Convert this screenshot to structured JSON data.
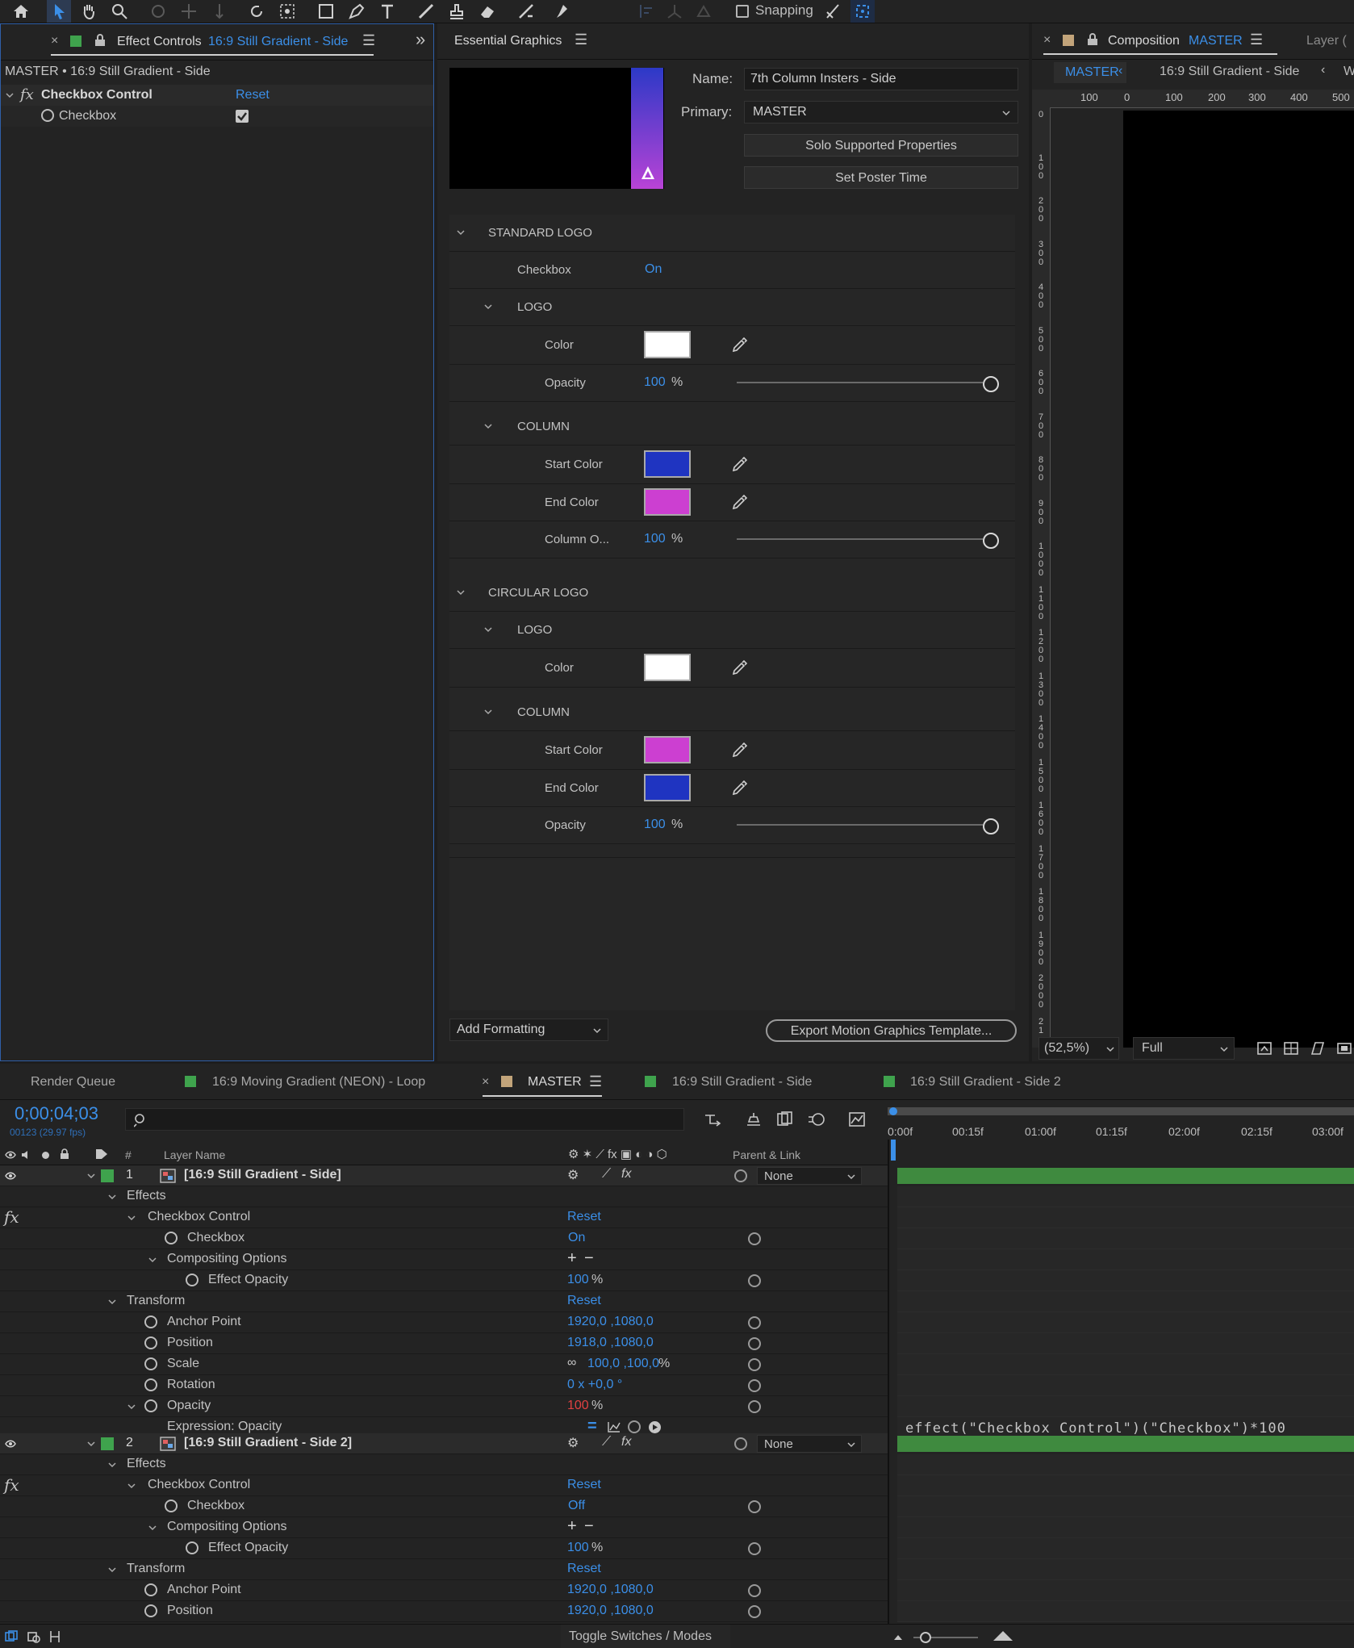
{
  "toolbar": {
    "snapping_label": "Snapping"
  },
  "effect_controls": {
    "tab_title": "Effect Controls",
    "tab_layer": "16:9 Still Gradient - Side",
    "breadcrumb": "MASTER • 16:9 Still Gradient - Side",
    "effect_name": "Checkbox Control",
    "reset_label": "Reset",
    "checkbox_label": "Checkbox",
    "fx_glyph": "fx"
  },
  "essential_graphics": {
    "tab_title": "Essential Graphics",
    "name_label": "Name:",
    "name_value": "7th Column Insters - Side",
    "primary_label": "Primary:",
    "primary_value": "MASTER",
    "solo_button": "Solo Supported Properties",
    "poster_button": "Set Poster Time",
    "add_formatting": "Add Formatting",
    "export_button": "Export Motion Graphics Template...",
    "rows": {
      "standard_logo": "STANDARD LOGO",
      "checkbox_label": "Checkbox",
      "checkbox_value": "On",
      "logo1": "LOGO",
      "color1_label": "Color",
      "opacity1_label": "Opacity",
      "opacity1_value": "100",
      "opacity1_unit": "%",
      "column1": "COLUMN",
      "start1_label": "Start Color",
      "end1_label": "End Color",
      "colop_label": "Column O...",
      "colop_value": "100",
      "colop_unit": "%",
      "circular_logo": "CIRCULAR LOGO",
      "logo2": "LOGO",
      "color2_label": "Color",
      "column2": "COLUMN",
      "start2_label": "Start Color",
      "end2_label": "End Color",
      "opacity2_label": "Opacity",
      "opacity2_value": "100",
      "opacity2_unit": "%"
    },
    "colors": {
      "white": "#ffffff",
      "blue": "#1f34c1",
      "magenta": "#cc3fd1"
    }
  },
  "composition": {
    "tab_label": "Composition",
    "tab_comp": "MASTER",
    "layer_tab": "Layer (",
    "crumb_master": "MASTER",
    "crumb_comp": "16:9 Still Gradient - Side",
    "crumb_w": "W",
    "ruler_ticks": [
      "100",
      "0",
      "100",
      "200",
      "300",
      "400",
      "500"
    ],
    "vruler_ticks": [
      "0",
      "1 0 0",
      "2 0 0",
      "3 0 0",
      "4 0 0",
      "5 0 0",
      "6 0 0",
      "7 0 0",
      "8 0 0",
      "9 0 0",
      "1 0 0 0",
      "1 1 0 0",
      "1 2 0 0",
      "1 3 0 0",
      "1 4 0 0",
      "1 5 0 0",
      "1 6 0 0",
      "1 7 0 0",
      "1 8 0 0",
      "1 9 0 0",
      "2 0 0 0",
      "2 1"
    ],
    "zoom_value": "(52,5%)",
    "resolution_value": "Full"
  },
  "timeline": {
    "tabs": {
      "render_queue": "Render Queue",
      "moving_gradient": "16:9 Moving Gradient (NEON) - Loop",
      "master": "MASTER",
      "still_side": "16:9 Still Gradient - Side",
      "still_side2": "16:9 Still Gradient - Side 2"
    },
    "timecode": "0;00;04;03",
    "frame_info": "00123 (29.97 fps)",
    "header": {
      "hash": "#",
      "layer_name": "Layer Name",
      "parent": "Parent & Link"
    },
    "ruler": [
      "0:00f",
      "00:15f",
      "01:00f",
      "01:15f",
      "02:00f",
      "02:15f",
      "03:00f"
    ],
    "layer1": {
      "num": "1",
      "name": "[16:9 Still Gradient - Side]",
      "parent": "None",
      "effects": "Effects",
      "checkbox_control": "Checkbox Control",
      "reset": "Reset",
      "checkbox": "Checkbox",
      "checkbox_value": "On",
      "compositing": "Compositing Options",
      "effect_opacity": "Effect Opacity",
      "effect_opacity_value": "100",
      "pct": "%",
      "transform": "Transform",
      "transform_reset": "Reset",
      "anchor": "Anchor Point",
      "anchor_value": "1920,0 ,1080,0",
      "position": "Position",
      "position_value": "1918,0 ,1080,0",
      "scale": "Scale",
      "scale_value": "100,0 ,100,0",
      "rotation": "Rotation",
      "rotation_value": "0 x +0,0 °",
      "opacity": "Opacity",
      "opacity_value": "100",
      "expression_label": "Expression: Opacity",
      "expression_code": "effect(\"Checkbox Control\")(\"Checkbox\")*100"
    },
    "layer2": {
      "num": "2",
      "name": "[16:9 Still Gradient - Side 2]",
      "parent": "None",
      "effects": "Effects",
      "checkbox_control": "Checkbox Control",
      "reset": "Reset",
      "checkbox": "Checkbox",
      "checkbox_value": "Off",
      "compositing": "Compositing Options",
      "effect_opacity": "Effect Opacity",
      "effect_opacity_value": "100",
      "pct": "%",
      "transform": "Transform",
      "transform_reset": "Reset",
      "anchor": "Anchor Point",
      "anchor_value": "1920,0 ,1080,0",
      "position": "Position",
      "position_value": "1920,0 ,1080,0"
    },
    "toggle_label": "Toggle Switches / Modes"
  }
}
